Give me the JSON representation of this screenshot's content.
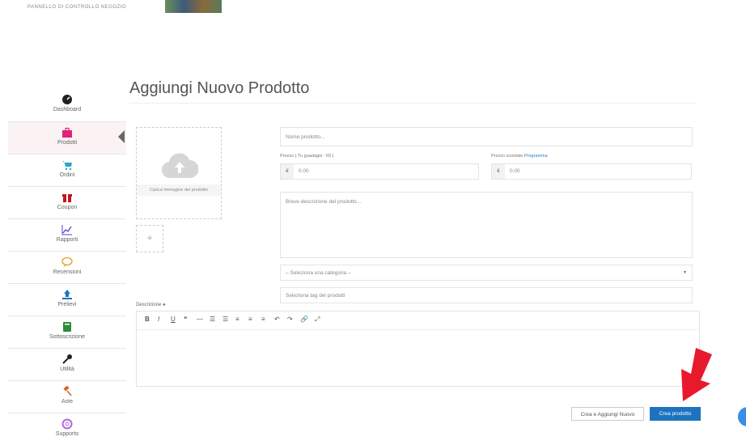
{
  "header": {
    "caption": "PANNELLO DI CONTROLLO NEGOZIO"
  },
  "sidebar": {
    "items": [
      {
        "label": "Dashboard",
        "icon": "dashboard-icon"
      },
      {
        "label": "Prodotti",
        "icon": "briefcase-icon"
      },
      {
        "label": "Ordini",
        "icon": "cart-icon"
      },
      {
        "label": "Coupon",
        "icon": "gift-icon"
      },
      {
        "label": "Rapporti",
        "icon": "chart-icon"
      },
      {
        "label": "Recensioni",
        "icon": "comment-icon"
      },
      {
        "label": "Prelievi",
        "icon": "upload-icon"
      },
      {
        "label": "Sottoscrizione",
        "icon": "book-icon"
      },
      {
        "label": "Utilità",
        "icon": "wrench-icon"
      },
      {
        "label": "Aste",
        "icon": "gavel-icon"
      },
      {
        "label": "Supporto",
        "icon": "lifebuoy-icon"
      }
    ]
  },
  "main": {
    "title": "Aggiungi Nuovo Prodotto",
    "image_upload_label": "Carica immagine del prodotto",
    "add_gallery": "+",
    "name_placeholder": "Nome prodotto...",
    "price_label": "Prezzo ( Tu guadagni : €0 )",
    "discount_label": "Prezzo scontato",
    "discount_link": "Programma",
    "currency": "€",
    "price_value": "0.00",
    "discount_value": "0.00",
    "short_desc_placeholder": "Breve descrizione del prodotto...",
    "category_placeholder": "– Seleziona una categoria –",
    "tags_placeholder": "Seleziona tag del prodotti",
    "description_label": "Descrizione",
    "toolbar": [
      "B",
      "I",
      "U",
      "❝",
      "—",
      "☰",
      "☰",
      "≡",
      "≡",
      "≡",
      "↶",
      "↷",
      "🔗",
      "⤢"
    ],
    "btn_create_add": "Crea e Aggiungi Nuovo",
    "btn_create": "Crea prodotto"
  },
  "colors": {
    "primary": "#1e73be",
    "accent_red": "#e8192c",
    "active_bg": "#fbf3f3"
  }
}
